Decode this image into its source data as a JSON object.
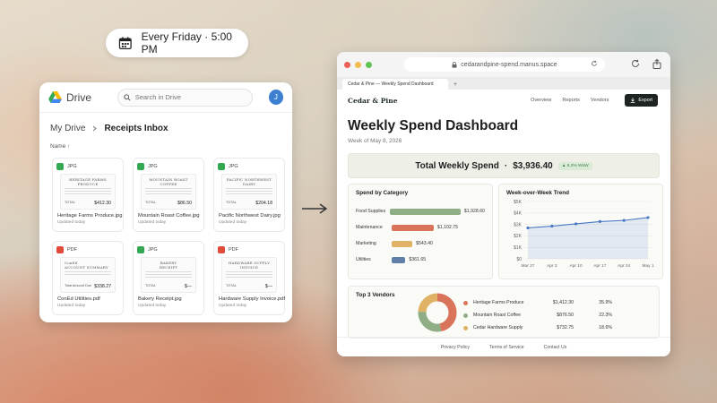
{
  "schedule": {
    "label": "Every Friday · 5:00 PM"
  },
  "drive": {
    "app_name": "Drive",
    "search_placeholder": "Search in Drive",
    "avatar_initial": "J",
    "breadcrumb": [
      "My Drive",
      "Receipts Inbox"
    ],
    "sort_label": "Name ↑",
    "files": [
      {
        "type": "JPG",
        "receipt_title": "HERITAGE FARMS\nPRODUCE",
        "total_label": "TOTAL",
        "total": "$412.30",
        "name": "Heritage Farms Produce.jpg",
        "updated": "Updated today"
      },
      {
        "type": "JPG",
        "receipt_title": "MOUNTAIN ROAST\nCOFFEE",
        "total_label": "TOTAL",
        "total": "$86.50",
        "name": "Mountain Roast Coffee.jpg",
        "updated": "Updated today"
      },
      {
        "type": "JPG",
        "receipt_title": "PACIFIC NORTHWEST\nDAIRY",
        "total_label": "TOTAL",
        "total": "$204.18",
        "name": "Pacific Northwest Dairy.jpg",
        "updated": "Updated today"
      },
      {
        "type": "PDF",
        "receipt_title": "ConEd\nACCOUNT SUMMARY",
        "total_label": "Total Amount Due",
        "total": "$338.27",
        "name": "ConEd Utilities.pdf",
        "updated": "Updated today"
      },
      {
        "type": "JPG",
        "receipt_title": "BAKERY\nRECEIPT",
        "total_label": "TOTAL",
        "total": "$—",
        "name": "Bakery Receipt.jpg",
        "updated": "Updated today"
      },
      {
        "type": "PDF",
        "receipt_title": "HARDWARE SUPPLY\nINVOICE",
        "total_label": "TOTAL",
        "total": "$—",
        "name": "Hardware Supply Invoice.pdf",
        "updated": "Updated today"
      }
    ]
  },
  "browser": {
    "url": "cedarandpine-spend.manus.space",
    "tab_title": "Cedar & Pine — Weekly Spend Dashboard",
    "new_tab": "+"
  },
  "dashboard": {
    "brand": "Cedar & Pine",
    "nav": [
      "Overview",
      "Reports",
      "Vendors"
    ],
    "export_label": "Export",
    "title": "Weekly Spend Dashboard",
    "subtitle": "Week of May 8, 2026",
    "total_label": "Total Weekly Spend",
    "total_sep": "·",
    "total_value": "$3,936.40",
    "wow_badge": "▲ 6.2% WoW",
    "category_title": "Spend by Category",
    "trend_title": "Week-over-Week Trend",
    "vendors_title": "Top 3 Vendors",
    "footer": [
      "Privacy Policy",
      "Terms of Service",
      "Contact Us"
    ]
  },
  "chart_data": [
    {
      "type": "bar",
      "title": "Spend by Category",
      "categories": [
        "Food Supplies",
        "Maintenance",
        "Marketing",
        "Utilities"
      ],
      "values": [
        1928.6,
        1102.75,
        543.4,
        361.65
      ],
      "value_labels": [
        "$1,928.60",
        "$1,102.75",
        "$543.40",
        "$361.65"
      ],
      "colors": [
        "#8fae86",
        "#d9745a",
        "#e0b265",
        "#5f7fa8"
      ]
    },
    {
      "type": "line",
      "title": "Week-over-Week Trend",
      "x": [
        "Mar 27",
        "Apr 3",
        "Apr 10",
        "Apr 17",
        "Apr 24",
        "May 1"
      ],
      "values": [
        2700,
        2850,
        3050,
        3250,
        3350,
        3600
      ],
      "yticks": [
        "$0",
        "$1K",
        "$2K",
        "$3K",
        "$4K",
        "$5K"
      ],
      "ylim": [
        0,
        5000
      ],
      "color": "#4a79c4"
    },
    {
      "type": "pie",
      "title": "Top 3 Vendors",
      "labels": [
        "Heritage Farms Produce",
        "Mountain Roast Coffee",
        "Cedar Hardware Supply"
      ],
      "amounts": [
        "$1,412.30",
        "$876.50",
        "$732.75"
      ],
      "values": [
        35.9,
        22.3,
        18.6
      ],
      "percents": [
        "35.9%",
        "22.3%",
        "18.6%"
      ],
      "colors": [
        "#d9745a",
        "#8fae86",
        "#e0b265"
      ]
    }
  ]
}
